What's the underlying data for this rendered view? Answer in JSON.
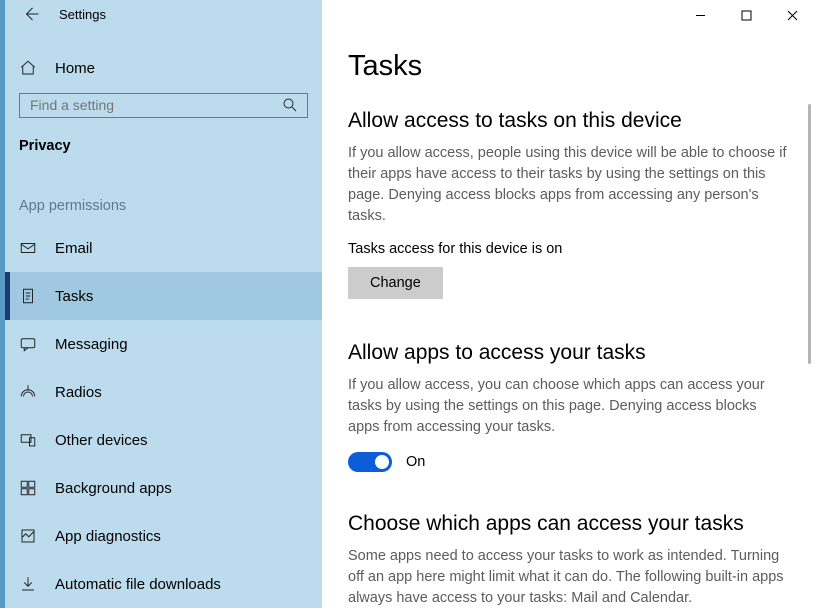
{
  "window": {
    "title": "Settings"
  },
  "sidebar": {
    "home": "Home",
    "search_placeholder": "Find a setting",
    "category": "Privacy",
    "subhead": "App permissions",
    "items": [
      {
        "label": "Email"
      },
      {
        "label": "Tasks"
      },
      {
        "label": "Messaging"
      },
      {
        "label": "Radios"
      },
      {
        "label": "Other devices"
      },
      {
        "label": "Background apps"
      },
      {
        "label": "App diagnostics"
      },
      {
        "label": "Automatic file downloads"
      }
    ]
  },
  "main": {
    "title": "Tasks",
    "sec1": {
      "heading": "Allow access to tasks on this device",
      "desc": "If you allow access, people using this device will be able to choose if their apps have access to their tasks by using the settings on this page. Denying access blocks apps from accessing any person's tasks.",
      "status": "Tasks access for this device is on",
      "btn": "Change"
    },
    "sec2": {
      "heading": "Allow apps to access your tasks",
      "desc": "If you allow access, you can choose which apps can access your tasks by using the settings on this page. Denying access blocks apps from accessing your tasks.",
      "toggle_label": "On"
    },
    "sec3": {
      "heading": "Choose which apps can access your tasks",
      "desc": "Some apps need to access your tasks to work as intended. Turning off an app here might limit what it can do. The following built-in apps always have access to your tasks: Mail and Calendar."
    }
  }
}
